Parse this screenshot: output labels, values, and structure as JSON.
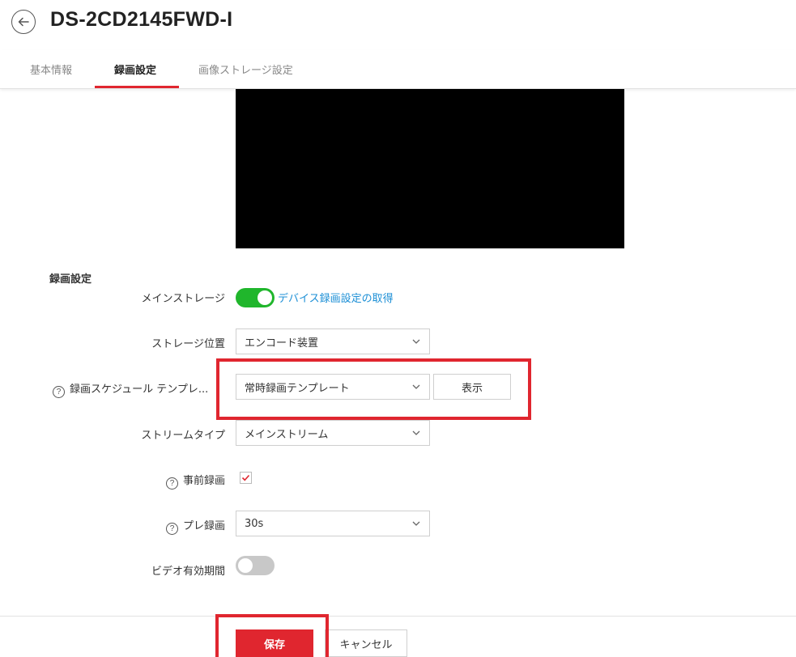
{
  "header": {
    "title": "DS-2CD2145FWD-I"
  },
  "tabs": [
    {
      "label": "基本情報",
      "active": false
    },
    {
      "label": "録画設定",
      "active": true
    },
    {
      "label": "画像ストレージ設定",
      "active": false
    }
  ],
  "section_title": "録画設定",
  "form": {
    "main_storage": {
      "label": "メインストレージ",
      "enabled": true,
      "link": "デバイス録画設定の取得"
    },
    "storage_location": {
      "label": "ストレージ位置",
      "value": "エンコード装置"
    },
    "schedule_template": {
      "label": "録画スケジュール テンプレ...",
      "value": "常時録画テンプレート",
      "view_button": "表示"
    },
    "stream_type": {
      "label": "ストリームタイプ",
      "value": "メインストリーム"
    },
    "pre_record": {
      "label": "事前録画",
      "checked": true
    },
    "pre_record_time": {
      "label": "プレ録画",
      "value": "30s"
    },
    "video_validity": {
      "label": "ビデオ有効期間",
      "enabled": false
    }
  },
  "footer": {
    "save_label": "保存",
    "cancel_label": "キャンセル"
  },
  "colors": {
    "accent": "#e0262f",
    "toggle_on": "#20b62c",
    "link": "#1c8fd6"
  }
}
